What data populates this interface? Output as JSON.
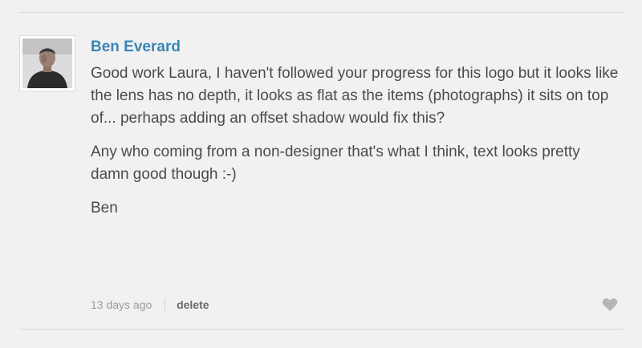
{
  "comment": {
    "author": "Ben Everard",
    "paragraphs": [
      "Good work Laura, I haven't followed your progress for this logo but it looks like the lens has no depth, it looks as flat as the items (photographs) it sits on top of... perhaps adding an offset shadow would fix this?",
      "Any who coming from a non-designer that's what I think, text looks pretty damn good though :-)",
      "Ben"
    ],
    "timestamp": "13 days ago",
    "delete_label": "delete",
    "like_icon": "heart-icon"
  },
  "colors": {
    "background": "#f1f1f1",
    "author_link": "#3a85b5",
    "body_text": "#4b4b4b",
    "meta_text": "#9a9a9a",
    "delete_text": "#6a6a6a",
    "heart": "#b5b5b5"
  }
}
